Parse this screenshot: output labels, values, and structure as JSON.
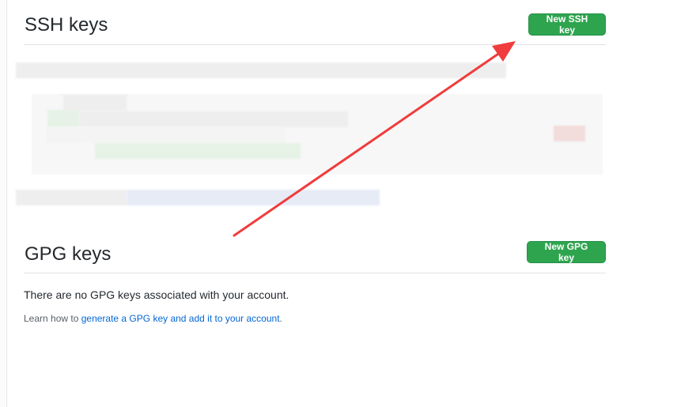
{
  "ssh": {
    "title": "SSH keys",
    "new_button": "New SSH key"
  },
  "gpg": {
    "title": "GPG keys",
    "new_button": "New GPG key",
    "empty_message": "There are no GPG keys associated with your account.",
    "learn_prefix": "Learn how to ",
    "learn_link": "generate a GPG key and add it to your account",
    "learn_suffix": "."
  },
  "colors": {
    "primary_button": "#2ea44f",
    "link": "#0366d6",
    "annotation_arrow": "#f03c3c"
  }
}
